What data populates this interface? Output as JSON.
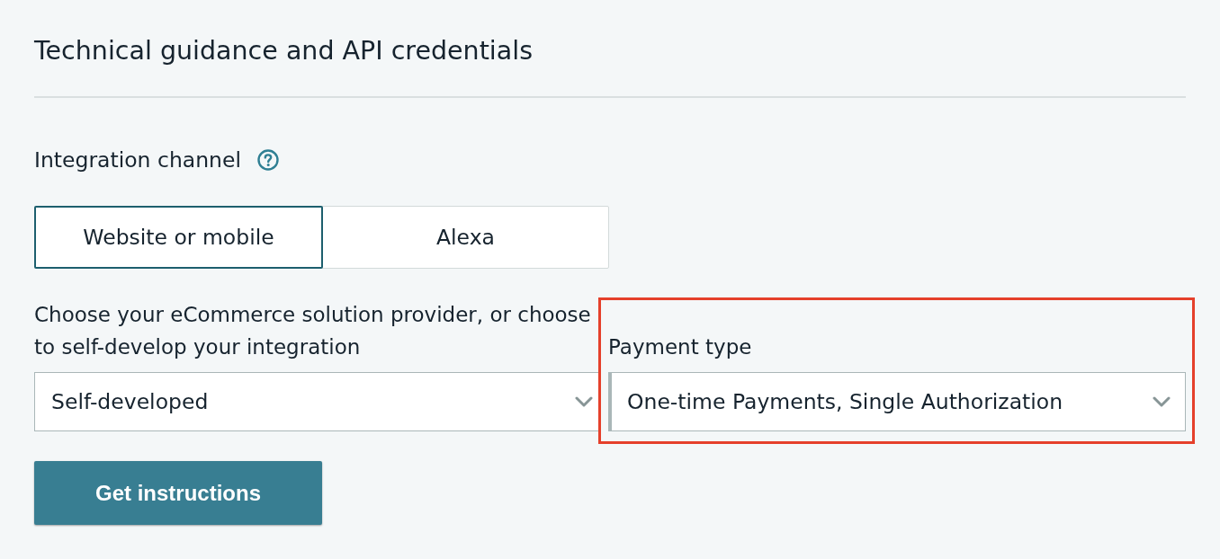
{
  "header": {
    "title": "Technical guidance and API credentials"
  },
  "integration_channel": {
    "label": "Integration channel",
    "options": [
      {
        "label": "Website or mobile",
        "selected": true
      },
      {
        "label": "Alexa",
        "selected": false
      }
    ]
  },
  "provider": {
    "label": "Choose your eCommerce solution provider, or choose to self-develop your integration",
    "value": "Self-developed"
  },
  "payment_type": {
    "label": "Payment type",
    "value": "One-time Payments, Single Authorization",
    "highlighted": true
  },
  "primary_button": {
    "label": "Get instructions"
  }
}
